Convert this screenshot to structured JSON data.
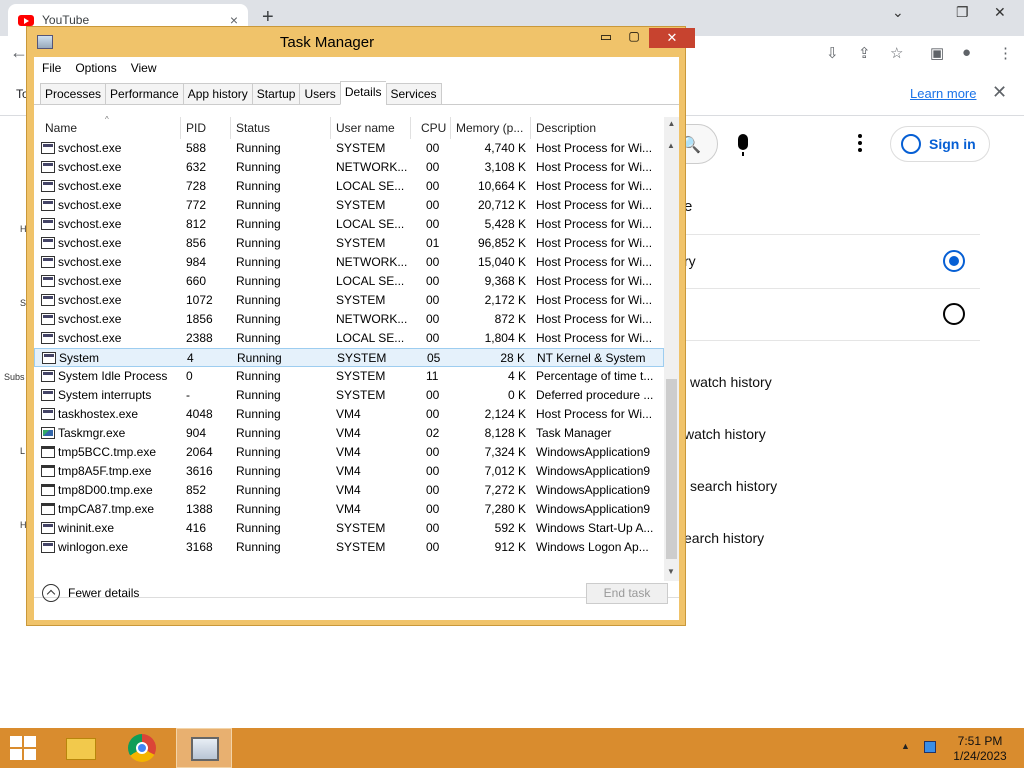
{
  "browser": {
    "tab_title": "YouTube",
    "tab_close": "×",
    "new_tab": "+",
    "win_min": "⌄",
    "win_restore": "❐",
    "win_close": "✕",
    "infobar_left": "To",
    "learn_more": "Learn more",
    "infobar_close": "✕"
  },
  "youtube": {
    "sign_in": "Sign in",
    "frag_e": "e",
    "frag_ry": "ry",
    "items": [
      "watch history",
      "watch history",
      "search history",
      "earch history"
    ],
    "left_frags": [
      "H",
      "S",
      "Subs",
      "L",
      "H"
    ]
  },
  "taskmgr": {
    "title": "Task Manager",
    "min": "▭",
    "max": "▢",
    "close": "✕",
    "menu": [
      "File",
      "Options",
      "View"
    ],
    "tabs": [
      "Processes",
      "Performance",
      "App history",
      "Startup",
      "Users",
      "Details",
      "Services"
    ],
    "active_tab": "Details",
    "columns": [
      "Name",
      "PID",
      "Status",
      "User name",
      "CPU",
      "Memory (p...",
      "Description"
    ],
    "rows": [
      {
        "name": "svchost.exe",
        "pid": "588",
        "status": "Running",
        "user": "SYSTEM",
        "cpu": "00",
        "mem": "4,740 K",
        "desc": "Host Process for Wi...",
        "icon": "proc"
      },
      {
        "name": "svchost.exe",
        "pid": "632",
        "status": "Running",
        "user": "NETWORK...",
        "cpu": "00",
        "mem": "3,108 K",
        "desc": "Host Process for Wi...",
        "icon": "proc"
      },
      {
        "name": "svchost.exe",
        "pid": "728",
        "status": "Running",
        "user": "LOCAL SE...",
        "cpu": "00",
        "mem": "10,664 K",
        "desc": "Host Process for Wi...",
        "icon": "proc"
      },
      {
        "name": "svchost.exe",
        "pid": "772",
        "status": "Running",
        "user": "SYSTEM",
        "cpu": "00",
        "mem": "20,712 K",
        "desc": "Host Process for Wi...",
        "icon": "proc"
      },
      {
        "name": "svchost.exe",
        "pid": "812",
        "status": "Running",
        "user": "LOCAL SE...",
        "cpu": "00",
        "mem": "5,428 K",
        "desc": "Host Process for Wi...",
        "icon": "proc"
      },
      {
        "name": "svchost.exe",
        "pid": "856",
        "status": "Running",
        "user": "SYSTEM",
        "cpu": "01",
        "mem": "96,852 K",
        "desc": "Host Process for Wi...",
        "icon": "proc"
      },
      {
        "name": "svchost.exe",
        "pid": "984",
        "status": "Running",
        "user": "NETWORK...",
        "cpu": "00",
        "mem": "15,040 K",
        "desc": "Host Process for Wi...",
        "icon": "proc"
      },
      {
        "name": "svchost.exe",
        "pid": "660",
        "status": "Running",
        "user": "LOCAL SE...",
        "cpu": "00",
        "mem": "9,368 K",
        "desc": "Host Process for Wi...",
        "icon": "proc"
      },
      {
        "name": "svchost.exe",
        "pid": "1072",
        "status": "Running",
        "user": "SYSTEM",
        "cpu": "00",
        "mem": "2,172 K",
        "desc": "Host Process for Wi...",
        "icon": "proc"
      },
      {
        "name": "svchost.exe",
        "pid": "1856",
        "status": "Running",
        "user": "NETWORK...",
        "cpu": "00",
        "mem": "872 K",
        "desc": "Host Process for Wi...",
        "icon": "proc"
      },
      {
        "name": "svchost.exe",
        "pid": "2388",
        "status": "Running",
        "user": "LOCAL SE...",
        "cpu": "00",
        "mem": "1,804 K",
        "desc": "Host Process for Wi...",
        "icon": "proc"
      },
      {
        "name": "System",
        "pid": "4",
        "status": "Running",
        "user": "SYSTEM",
        "cpu": "05",
        "mem": "28 K",
        "desc": "NT Kernel & System",
        "icon": "proc",
        "selected": true
      },
      {
        "name": "System Idle Process",
        "pid": "0",
        "status": "Running",
        "user": "SYSTEM",
        "cpu": "11",
        "mem": "4 K",
        "desc": "Percentage of time t...",
        "icon": "proc"
      },
      {
        "name": "System interrupts",
        "pid": "-",
        "status": "Running",
        "user": "SYSTEM",
        "cpu": "00",
        "mem": "0 K",
        "desc": "Deferred procedure ...",
        "icon": "proc"
      },
      {
        "name": "taskhostex.exe",
        "pid": "4048",
        "status": "Running",
        "user": "VM4",
        "cpu": "00",
        "mem": "2,124 K",
        "desc": "Host Process for Wi...",
        "icon": "proc"
      },
      {
        "name": "Taskmgr.exe",
        "pid": "904",
        "status": "Running",
        "user": "VM4",
        "cpu": "02",
        "mem": "8,128 K",
        "desc": "Task Manager",
        "icon": "tm"
      },
      {
        "name": "tmp5BCC.tmp.exe",
        "pid": "2064",
        "status": "Running",
        "user": "VM4",
        "cpu": "00",
        "mem": "7,324 K",
        "desc": "WindowsApplication9",
        "icon": "plain"
      },
      {
        "name": "tmp8A5F.tmp.exe",
        "pid": "3616",
        "status": "Running",
        "user": "VM4",
        "cpu": "00",
        "mem": "7,012 K",
        "desc": "WindowsApplication9",
        "icon": "plain"
      },
      {
        "name": "tmp8D00.tmp.exe",
        "pid": "852",
        "status": "Running",
        "user": "VM4",
        "cpu": "00",
        "mem": "7,272 K",
        "desc": "WindowsApplication9",
        "icon": "plain"
      },
      {
        "name": "tmpCA87.tmp.exe",
        "pid": "1388",
        "status": "Running",
        "user": "VM4",
        "cpu": "00",
        "mem": "7,280 K",
        "desc": "WindowsApplication9",
        "icon": "plain"
      },
      {
        "name": "wininit.exe",
        "pid": "416",
        "status": "Running",
        "user": "SYSTEM",
        "cpu": "00",
        "mem": "592 K",
        "desc": "Windows Start-Up A...",
        "icon": "proc"
      },
      {
        "name": "winlogon.exe",
        "pid": "3168",
        "status": "Running",
        "user": "SYSTEM",
        "cpu": "00",
        "mem": "912 K",
        "desc": "Windows Logon Ap...",
        "icon": "proc"
      }
    ],
    "fewer_details": "Fewer details",
    "end_task": "End task"
  },
  "taskbar": {
    "time": "7:51 PM",
    "date": "1/24/2023"
  },
  "colors": {
    "taskbar": "#d98c2e",
    "window_frame": "#f0c36a",
    "close_red": "#c7432f",
    "link_blue": "#1a73e8"
  }
}
